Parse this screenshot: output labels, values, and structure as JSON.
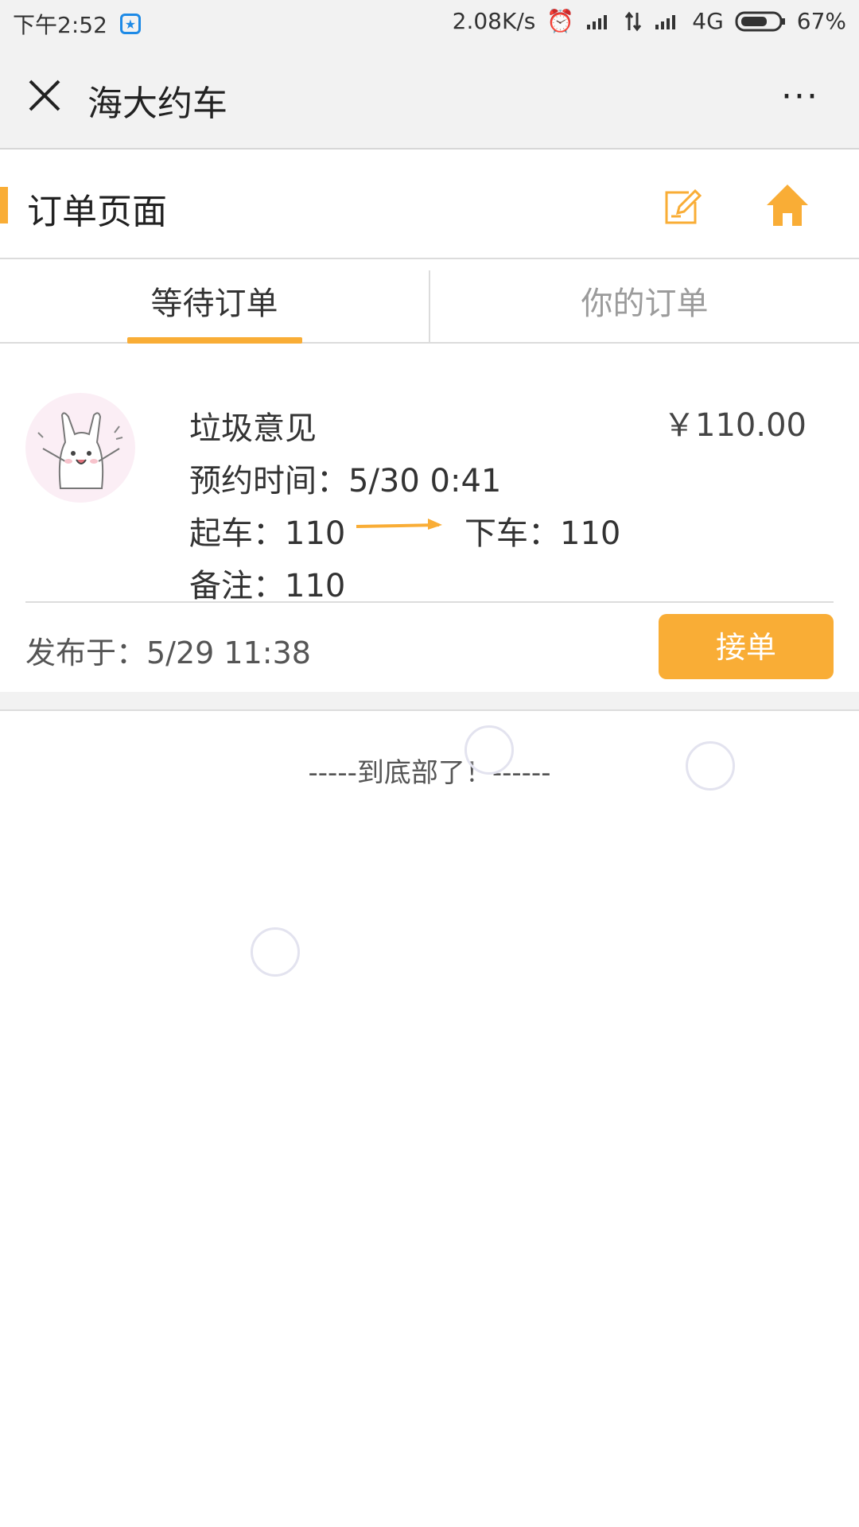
{
  "status_bar": {
    "time": "下午2:52",
    "network_speed": "2.08K/s",
    "network_type": "4G",
    "battery": "67%"
  },
  "nav": {
    "title": "海大约车",
    "more_label": "···"
  },
  "page_header": {
    "title": "订单页面"
  },
  "tabs": [
    {
      "label": "等待订单",
      "active": true
    },
    {
      "label": "你的订单",
      "active": false
    }
  ],
  "order": {
    "name": "垃圾意见",
    "price": "￥110.00",
    "time": "预约时间：5/30 0:41",
    "from": "起车：110",
    "to": "下车：110",
    "note": "备注：110",
    "published": "发布于：5/29 11:38",
    "accept_label": "接单"
  },
  "footer": {
    "bottom_text": "-----到底部了！------"
  },
  "colors": {
    "accent": "#f9ad36",
    "bar_bg": "#f2f2f2"
  }
}
